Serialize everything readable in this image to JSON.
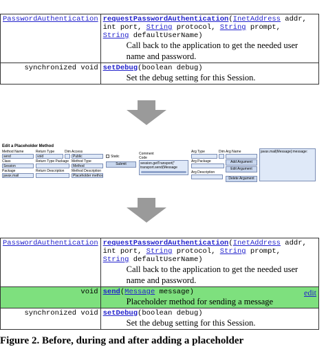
{
  "before_table": {
    "rows": [
      {
        "modifier": "PasswordAuthentication",
        "method": "requestPasswordAuthentication",
        "sig_line1_rest": "(",
        "param1_type": "InetAddress",
        "param1_name": " addr,",
        "line2_pre": "int port, ",
        "line2_type1": "String",
        "line2_mid": " protocol, ",
        "line2_type2": "String",
        "line2_post": " prompt,",
        "line3_type": "String",
        "line3_post": " defaultUserName)",
        "description": "Call back to the application to get the needed user name and password."
      },
      {
        "modifier": "synchronized void",
        "method": "setDebug",
        "params": "(boolean debug)",
        "description": "Set the debug setting for this Session."
      }
    ]
  },
  "editor": {
    "title": "Edit a Placeholder Method",
    "labels": {
      "method_name": "Method Name",
      "return_type": "Return Type",
      "dim": "Dim",
      "access": "Access",
      "class": "Class",
      "return_type_package": "Return Type Package",
      "method_type": "Method Type",
      "package": "Package",
      "return_description": "Return Description",
      "method_description": "Method Description",
      "static": "Static",
      "comment": "Comment",
      "code": "Code",
      "arg_type": "Arg Type",
      "arg_name": "Arg Name",
      "arg_package": "Arg Package",
      "arg_description": "Arg Description"
    },
    "values": {
      "method_name": "send",
      "return_type": "void",
      "access": "Public",
      "class": "Session",
      "method_type": "Method",
      "package": "javax.mail",
      "method_description": "Placeholder method",
      "code_line1": "session.getTransport(\"",
      "code_line2": "transport.send(Message",
      "arg_list_item": "javax.mail|Message|:message:"
    },
    "buttons": {
      "submit": "Submit",
      "add_argument": "Add Argument",
      "edit_argument": "Edit Argument",
      "delete_argument": "Delete Argument"
    }
  },
  "after_table": {
    "new_row": {
      "modifier": "void",
      "method": "send",
      "param_type": "Message",
      "param_name": " message)",
      "description": "Placeholder method for sending a message",
      "edit": "edit"
    }
  },
  "caption": "Figure 2. Before, during and after adding a placeholder",
  "colors": {
    "link": "#2222cc",
    "highlight_row": "#7ee07e",
    "arrow": "#9a9a9a",
    "ui_field": "#dfe9f8"
  }
}
